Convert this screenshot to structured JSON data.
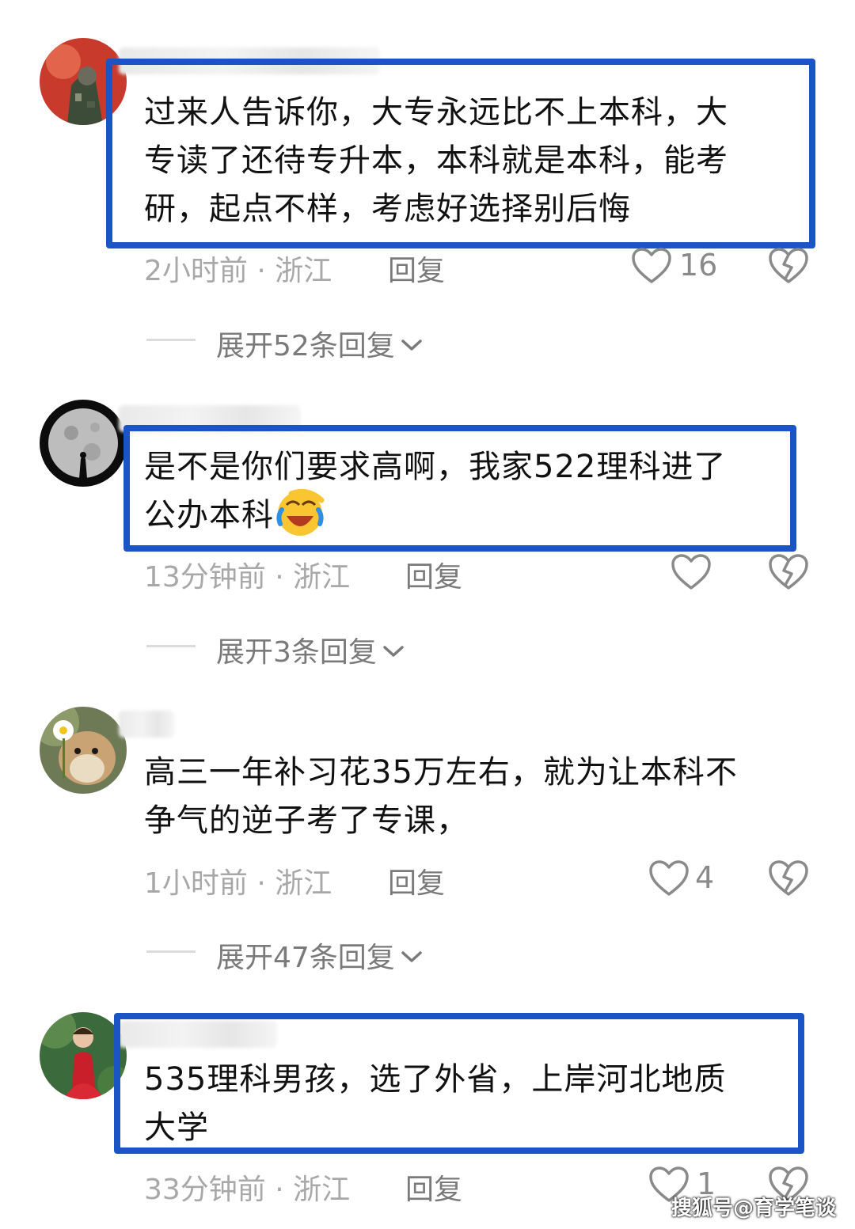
{
  "comments": [
    {
      "text": "过来人告诉你，大专永远比不上本科，大\n专读了还待专升本，本科就是本科，能考\n研，起点不样，考虑好选择别后悔",
      "time": "2小时前 · 浙江",
      "reply": "回复",
      "likes": "16",
      "expand": "展开52条回复"
    },
    {
      "text": "是不是你们要求高啊，我家522理科进了\n公办本科",
      "emoji": "laughing-crying-emoji",
      "time": "13分钟前 · 浙江",
      "reply": "回复",
      "likes": "",
      "expand": "展开3条回复"
    },
    {
      "text": "高三一年补习花35万左右，就为让本科不\n争气的逆子考了专课，",
      "time": "1小时前 · 浙江",
      "reply": "回复",
      "likes": "4",
      "expand": "展开47条回复"
    },
    {
      "text": "535理科男孩，选了外省，上岸河北地质\n大学",
      "time": "33分钟前 · 浙江",
      "reply": "回复",
      "likes": "1"
    }
  ],
  "icons": {
    "like": "heart-outline-icon",
    "dislike": "broken-heart-icon",
    "expand": "chevron-down-icon"
  },
  "colors": {
    "highlight_box": "#1b54c5",
    "meta_text": "#a8a8a8",
    "reply_text": "#7a7a7a"
  },
  "watermark": "搜狐号@育学笔谈"
}
